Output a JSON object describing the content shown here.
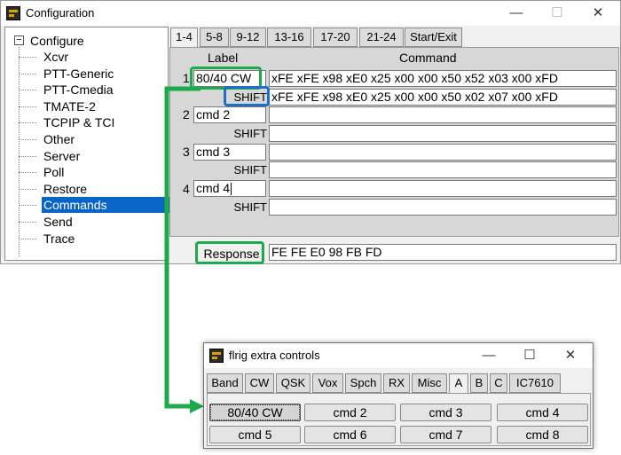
{
  "config_window": {
    "title": "Configuration",
    "controls": {
      "minimize": "—",
      "maximize": "☐",
      "close": "✕"
    },
    "tree": {
      "root": "Configure",
      "expander": "−",
      "items": [
        "Xcvr",
        "PTT-Generic",
        "PTT-Cmedia",
        "TMATE-2",
        "TCPIP & TCI",
        "Other",
        "Server",
        "Poll",
        "Restore",
        "Commands",
        "Send",
        "Trace"
      ],
      "selected": "Commands"
    },
    "tabs": [
      "1-4",
      "5-8",
      "9-12",
      "13-16",
      "17-20",
      "21-24",
      "Start/Exit"
    ],
    "active_tab": "1-4",
    "headers": {
      "label": "Label",
      "command": "Command"
    },
    "shift_label": "SHIFT",
    "rows": [
      {
        "num": "1",
        "label": "80/40 CW",
        "command": "xFE xFE x98 xE0 x25 x00 x00 x50 x52 x03 x00 xFD",
        "shift_command": "xFE xFE x98 xE0 x25 x00 x00 x50 x02 x07 x00 xFD"
      },
      {
        "num": "2",
        "label": "cmd 2",
        "command": "",
        "shift_command": ""
      },
      {
        "num": "3",
        "label": "cmd 3",
        "command": "",
        "shift_command": ""
      },
      {
        "num": "4",
        "label": "cmd 4",
        "command": "",
        "shift_command": ""
      }
    ],
    "response_label": "Response",
    "response_value": "FE FE E0 98 FB FD"
  },
  "extra_window": {
    "title": "flrig extra controls",
    "controls": {
      "minimize": "—",
      "maximize": "☐",
      "close": "✕"
    },
    "tabs": [
      "Band",
      "CW",
      "QSK",
      "Vox",
      "Spch",
      "RX",
      "Misc",
      "A",
      "B",
      "C",
      "IC7610"
    ],
    "active_tab": "A",
    "buttons": [
      "80/40 CW",
      "cmd 2",
      "cmd 3",
      "cmd 4",
      "cmd 5",
      "cmd 6",
      "cmd 7",
      "cmd 8"
    ]
  },
  "colors": {
    "highlight_green": "#1daa4b",
    "highlight_blue": "#1e6ed0",
    "selection": "#0a64c8"
  }
}
